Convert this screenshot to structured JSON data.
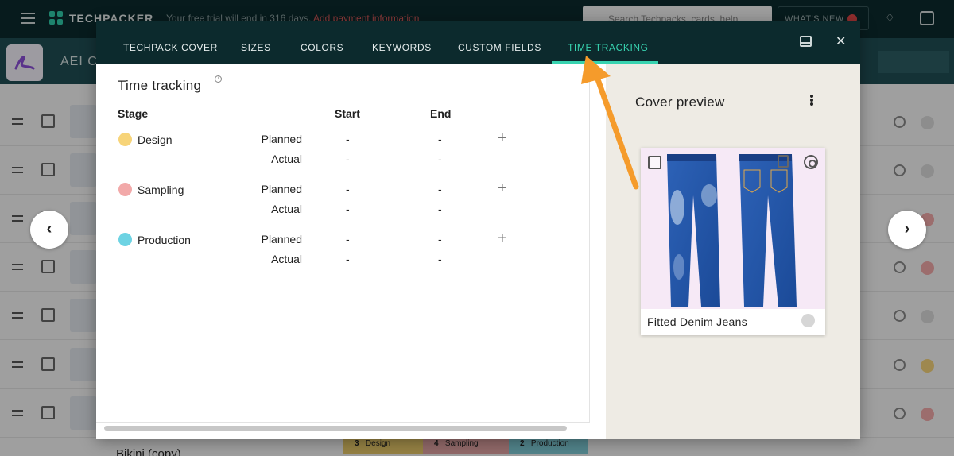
{
  "app": {
    "brand": "TECHPACKER",
    "trial_text": "Your free trial will end in 316 days.",
    "trial_link": "Add payment information",
    "search_placeholder": "Search Techpacks, cards, help",
    "whats_new": "WHAT'S NEW",
    "project_title": "AEI C"
  },
  "background": {
    "bottom_item_title": "Bikini (copy)",
    "chips": [
      {
        "count": "3",
        "label": "Design"
      },
      {
        "count": "4",
        "label": "Sampling"
      },
      {
        "count": "2",
        "label": "Production"
      }
    ],
    "row_status_colors": [
      "#d9d9d9",
      "#d9d9d9",
      "#f0a8a8",
      "#f0a8a8",
      "#d9d9d9",
      "#f3d27a",
      "#f0a8a8"
    ]
  },
  "modal": {
    "tabs": [
      {
        "label": "TECHPACK COVER"
      },
      {
        "label": "SIZES"
      },
      {
        "label": "COLORS"
      },
      {
        "label": "KEYWORDS"
      },
      {
        "label": "CUSTOM FIELDS"
      },
      {
        "label": "TIME TRACKING",
        "active": true
      }
    ],
    "icons": {
      "layout": "panel-layout-icon",
      "close": "close-icon"
    },
    "section_title": "Time tracking",
    "columns": {
      "stage": "Stage",
      "start": "Start",
      "end": "End"
    },
    "stages": [
      {
        "name": "Design",
        "color": "#f7d479",
        "planned_label": "Planned",
        "actual_label": "Actual",
        "planned_start": "-",
        "planned_end": "-",
        "actual_start": "-",
        "actual_end": "-"
      },
      {
        "name": "Sampling",
        "color": "#f2a9a9",
        "planned_label": "Planned",
        "actual_label": "Actual",
        "planned_start": "-",
        "planned_end": "-",
        "actual_start": "-",
        "actual_end": "-"
      },
      {
        "name": "Production",
        "color": "#6dd3e3",
        "planned_label": "Planned",
        "actual_label": "Actual",
        "planned_start": "-",
        "planned_end": "-",
        "actual_start": "-",
        "actual_end": "-"
      }
    ],
    "cover_preview": {
      "title": "Cover preview",
      "card_name": "Fitted Denim Jeans"
    }
  },
  "colors": {
    "dark_teal": "#0c2a2d",
    "accent": "#38d3b0",
    "pointer": "#f59b2b"
  }
}
